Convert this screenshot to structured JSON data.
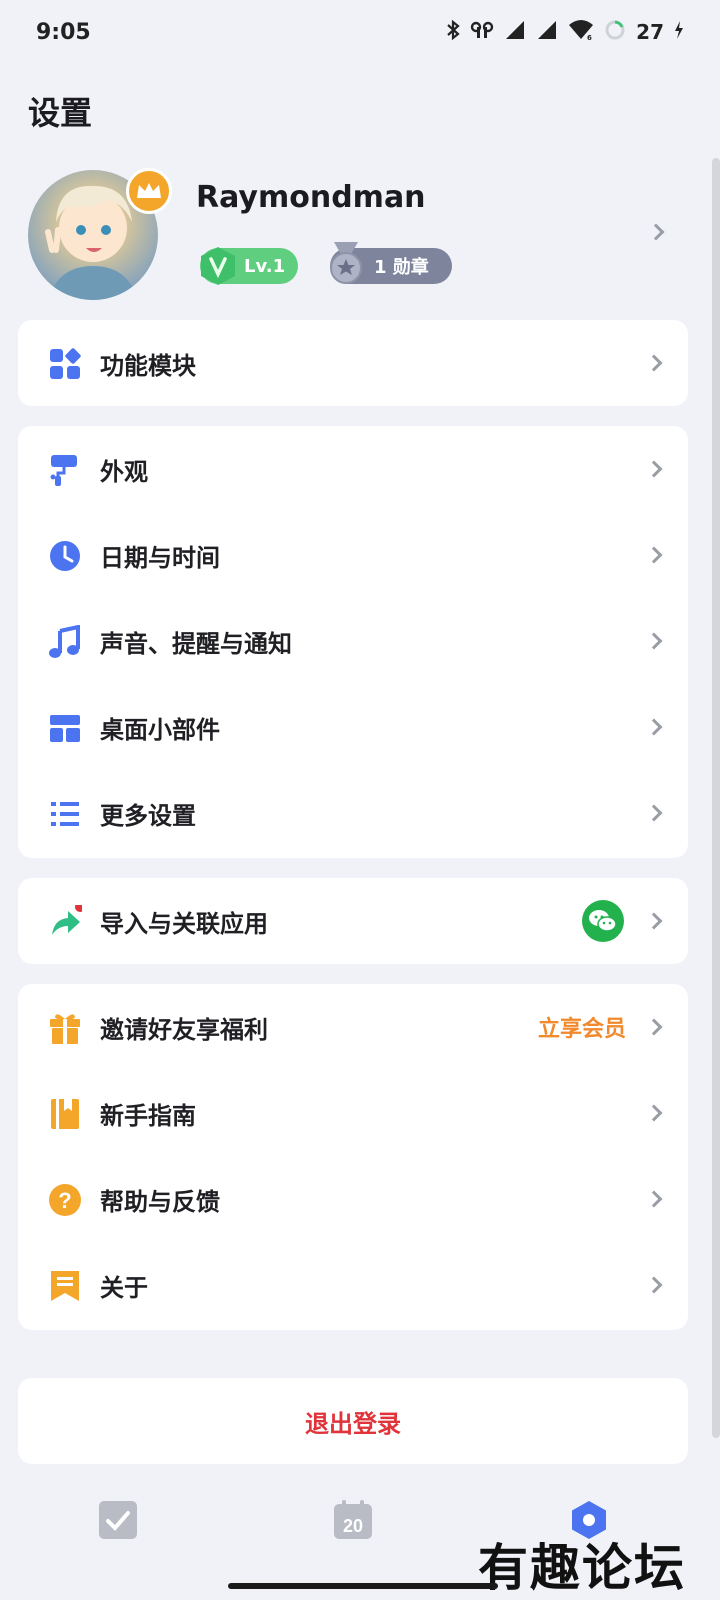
{
  "status_bar": {
    "time": "9:05",
    "battery": "27"
  },
  "page": {
    "title": "设置"
  },
  "profile": {
    "username": "Raymondman",
    "level": "Lv.1",
    "medals": "1 勋章"
  },
  "groups": [
    {
      "items": [
        {
          "label": "功能模块",
          "icon": "grid-icon"
        }
      ]
    },
    {
      "items": [
        {
          "label": "外观",
          "icon": "paint-roller-icon"
        },
        {
          "label": "日期与时间",
          "icon": "clock-icon"
        },
        {
          "label": "声音、提醒与通知",
          "icon": "music-note-icon"
        },
        {
          "label": "桌面小部件",
          "icon": "widget-icon"
        },
        {
          "label": "更多设置",
          "icon": "list-icon"
        }
      ]
    },
    {
      "items": [
        {
          "label": "导入与关联应用",
          "icon": "share-arrow-icon",
          "badge_icon": "wechat-icon"
        }
      ]
    },
    {
      "items": [
        {
          "label": "邀请好友享福利",
          "icon": "gift-icon",
          "extra": "立享会员"
        },
        {
          "label": "新手指南",
          "icon": "book-icon"
        },
        {
          "label": "帮助与反馈",
          "icon": "question-icon"
        },
        {
          "label": "关于",
          "icon": "info-flag-icon"
        }
      ]
    }
  ],
  "logout": {
    "label": "退出登录"
  },
  "tabbar": {
    "calendar_day": "20"
  },
  "watermark": "有趣论坛",
  "colors": {
    "accent_blue": "#4c73f0",
    "green": "#5fce7e",
    "orange": "#f4a62a",
    "logout_red": "#e0333a"
  }
}
